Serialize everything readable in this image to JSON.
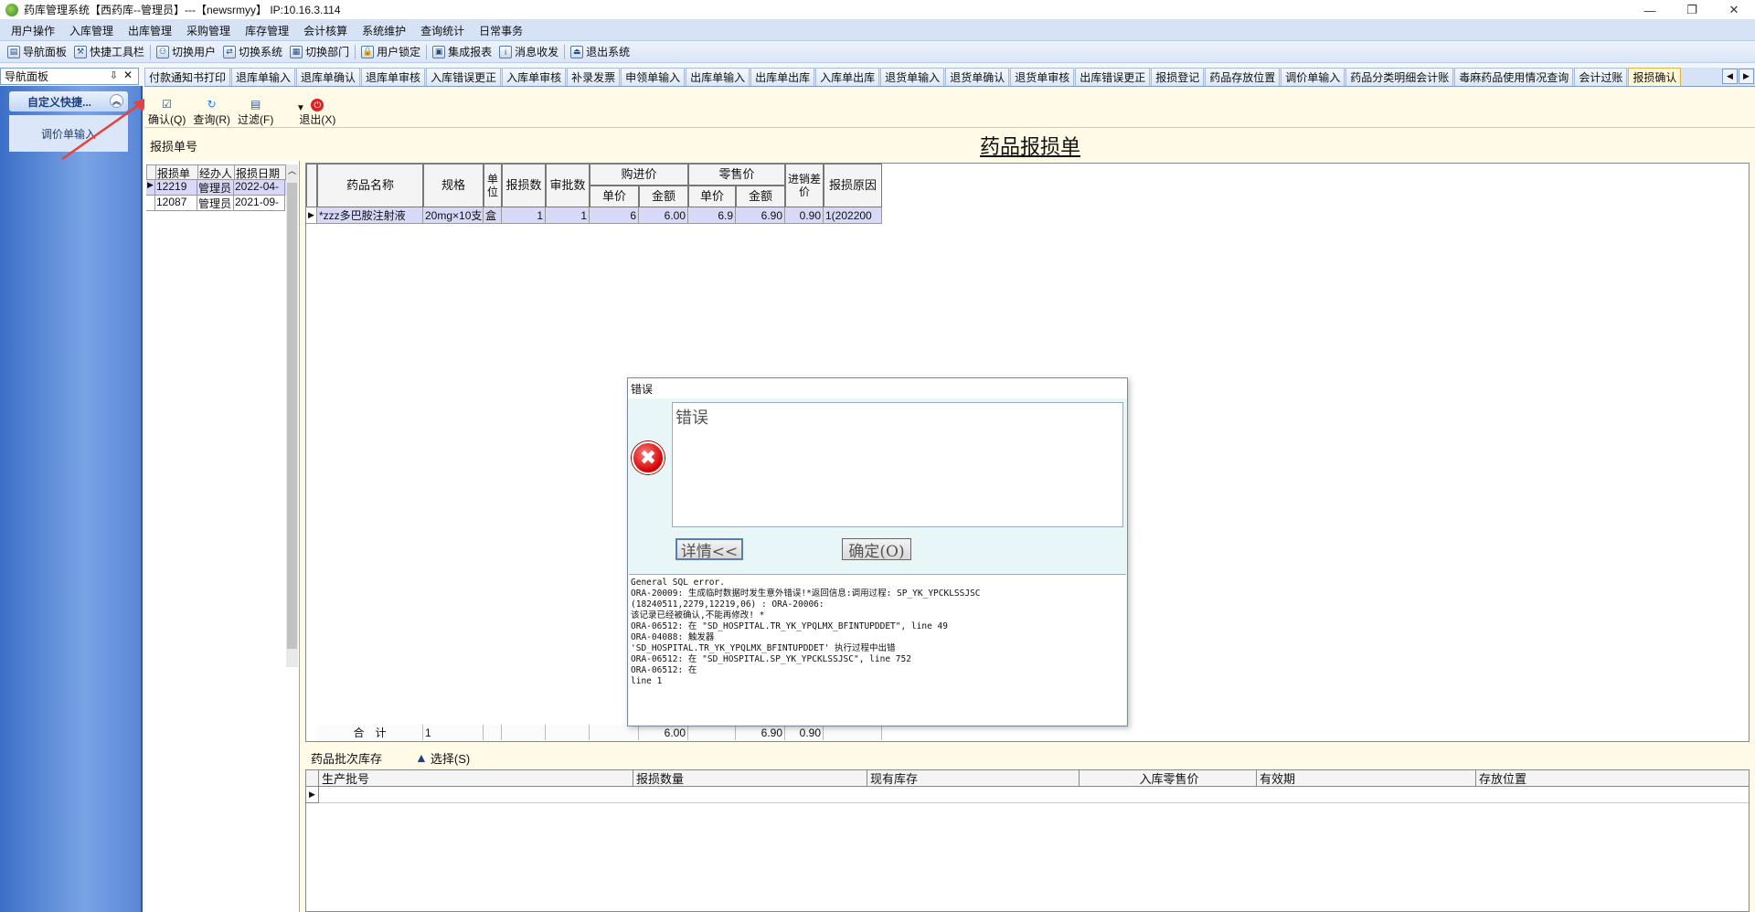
{
  "window": {
    "title": "药库管理系统【西药库--管理员】---【newsrmyy】 IP:10.16.3.114",
    "controls": [
      "—",
      "❐",
      "✕"
    ]
  },
  "menu": [
    "用户操作",
    "入库管理",
    "出库管理",
    "采购管理",
    "库存管理",
    "会计核算",
    "系统维护",
    "查询统计",
    "日常事务"
  ],
  "toolbar": [
    "导航面板",
    "快捷工具栏",
    "切换用户",
    "切换系统",
    "切换部门",
    "用户锁定",
    "集成报表",
    "消息收发",
    "退出系统"
  ],
  "nav": {
    "header": "导航面板",
    "pin": "⇩",
    "close": "✕",
    "group": "自定义快捷...",
    "item": "调价单输入"
  },
  "tabs": [
    "付款通知书打印",
    "退库单输入",
    "退库单确认",
    "退库单审核",
    "入库错误更正",
    "入库单审核",
    "补录发票",
    "申领单输入",
    "出库单输入",
    "出库单出库",
    "入库单出库",
    "退货单输入",
    "退货单确认",
    "退货单审核",
    "出库错误更正",
    "报损登记",
    "药品存放位置",
    "调价单输入",
    "药品分类明细会计账",
    "毒麻药品使用情况查询",
    "会计过账",
    "报损确认"
  ],
  "actions": {
    "confirm": "确认(Q)",
    "query": "查询(R)",
    "filter": "过滤(F)",
    "exit": "退出(X)"
  },
  "left": {
    "title": "报损单号",
    "columns": [
      "报损单",
      "经办人",
      "报损日期"
    ],
    "rows": [
      [
        "12219",
        "管理员",
        "2022-04-"
      ],
      [
        "12087",
        "管理员",
        "2021-09-"
      ]
    ]
  },
  "form": {
    "title": "药品报损单",
    "headers": {
      "name": "药品名称",
      "spec": "规格",
      "unit": "单位",
      "qty": "报损数",
      "approved": "审批数",
      "purchase": "购进价",
      "retail": "零售价",
      "unit_price": "单价",
      "amount": "金额",
      "diff": "进销差价",
      "reason": "报损原因"
    },
    "row": {
      "name": "*zzz多巴胺注射液",
      "spec": "20mg×10支",
      "unit": "盒",
      "qty": "1",
      "approved": "1",
      "p_price": "6",
      "p_amount": "6.00",
      "r_price": "6.9",
      "r_amount": "6.90",
      "diff": "0.90",
      "reason": "1(202200"
    },
    "total": {
      "label": "合　计",
      "qty": "1",
      "p_amount": "6.00",
      "r_amount": "6.90",
      "diff": "0.90"
    }
  },
  "lower": {
    "title": "药品批次库存",
    "select": "选择(S)",
    "columns": [
      "生产批号",
      "报损数量",
      "现有库存",
      "入库零售价",
      "有效期",
      "存放位置"
    ]
  },
  "dialog": {
    "title": "错误",
    "message": "错误",
    "details_btn": "详情<<",
    "ok_btn": "确定(O)",
    "detail_text": "General SQL error.\nORA-20009: 生成临时数据时发生意外错误!*返回信息:调用过程: SP_YK_YPCKLSSJSC\n(18240511,2279,12219,06) : ORA-20006:\n该记录已经被确认,不能再修改! *\nORA-06512: 在 \"SD_HOSPITAL.TR_YK_YPQLMX_BFINTUPDDET\", line 49\nORA-04088: 触发器\n'SD_HOSPITAL.TR_YK_YPQLMX_BFINTUPDDET' 执行过程中出错\nORA-06512: 在 \"SD_HOSPITAL.SP_YK_YPCKLSSJSC\", line 752\nORA-06512: 在\nline 1"
  }
}
